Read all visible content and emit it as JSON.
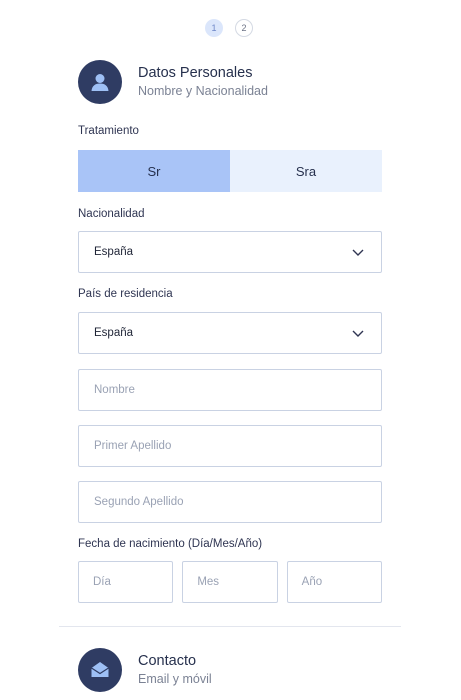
{
  "stepper": {
    "steps": [
      "1",
      "2"
    ],
    "active": 0
  },
  "section_personal": {
    "title": "Datos Personales",
    "subtitle": "Nombre y Nacionalidad",
    "icon": "user-icon"
  },
  "treatment": {
    "label": "Tratamiento",
    "options": [
      "Sr",
      "Sra"
    ],
    "selected": "Sr"
  },
  "nationality": {
    "label": "Nacionalidad",
    "value": "España"
  },
  "residence": {
    "label": "País de residencia",
    "value": "España"
  },
  "first_name": {
    "placeholder": "Nombre"
  },
  "last_name_1": {
    "placeholder": "Primer Apellido"
  },
  "last_name_2": {
    "placeholder": "Segundo Apellido"
  },
  "birth_date": {
    "label": "Fecha de nacimiento (Día/Mes/Año)",
    "day": "Día",
    "month": "Mes",
    "year": "Año"
  },
  "section_contact": {
    "title": "Contacto",
    "subtitle": "Email y móvil",
    "icon": "envelope-icon"
  },
  "colors": {
    "accent_selected": "#a9c4f7",
    "accent_unselected": "#e9f1fd",
    "icon_bg": "#2f3c63"
  }
}
